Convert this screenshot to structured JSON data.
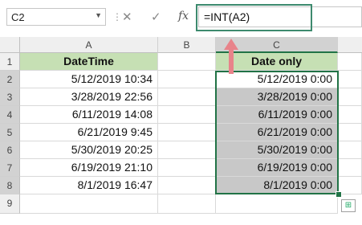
{
  "formula_bar": {
    "name_box": "C2",
    "cancel_glyph": "✕",
    "enter_glyph": "✓",
    "fx_label": "fx",
    "formula": "=INT(A2)"
  },
  "columns": [
    "A",
    "B",
    "C"
  ],
  "rows": [
    "1",
    "2",
    "3",
    "4",
    "5",
    "6",
    "7",
    "8",
    "9"
  ],
  "cells": {
    "a1": "DateTime",
    "c1": "Date only",
    "col_a": [
      "5/12/2019 10:34",
      "3/28/2019 22:56",
      "6/11/2019 14:08",
      "6/21/2019 9:45",
      "5/30/2019 20:25",
      "6/19/2019 21:10",
      "8/1/2019 16:47"
    ],
    "col_c": [
      "5/12/2019 0:00",
      "3/28/2019 0:00",
      "6/11/2019 0:00",
      "6/21/2019 0:00",
      "5/30/2019 0:00",
      "6/19/2019 0:00",
      "8/1/2019 0:00"
    ]
  },
  "colors": {
    "header_fill": "#c6e0b4",
    "selection_fill": "#c8c8c8",
    "selection_border": "#217346",
    "annotation": "#3d8a6e",
    "arrow": "#e8838a"
  }
}
